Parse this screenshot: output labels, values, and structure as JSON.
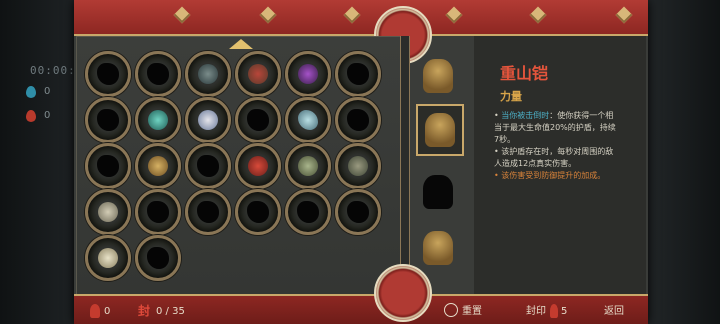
{
  "hud": {
    "timer": "00:00:",
    "stat_a": "0",
    "stat_b": "0"
  },
  "detail": {
    "title": "重山铠",
    "category": "力量",
    "lines": [
      {
        "pre": "• ",
        "hl": "当你被击倒时",
        "text": "：使你获得一个相"
      },
      {
        "pre": "",
        "hl": "",
        "text": "当于最大生命值20%的护盾，持续"
      },
      {
        "pre": "",
        "hl": "",
        "text": "7秒。"
      },
      {
        "pre": "• ",
        "hl": "",
        "text": "该护盾存在时，每秒对周围的敌"
      },
      {
        "pre": "",
        "hl": "",
        "text": "人造成12点真实伤害。"
      },
      {
        "pre": "• ",
        "hl": "",
        "text": "该伤害受到防御提升的加成。",
        "warn": true
      }
    ]
  },
  "bottom": {
    "currency": "0",
    "seal_label": "封",
    "seal_count": "0 / 35",
    "reset": "重置",
    "seal_cost_label": "封印",
    "seal_cost": "5",
    "back": "返回"
  },
  "colors": {
    "title": "#e5553c",
    "category": "#d9a54a",
    "highlight": "#4db0c7",
    "warn": "#d9833a",
    "bar": "#a6332d"
  }
}
